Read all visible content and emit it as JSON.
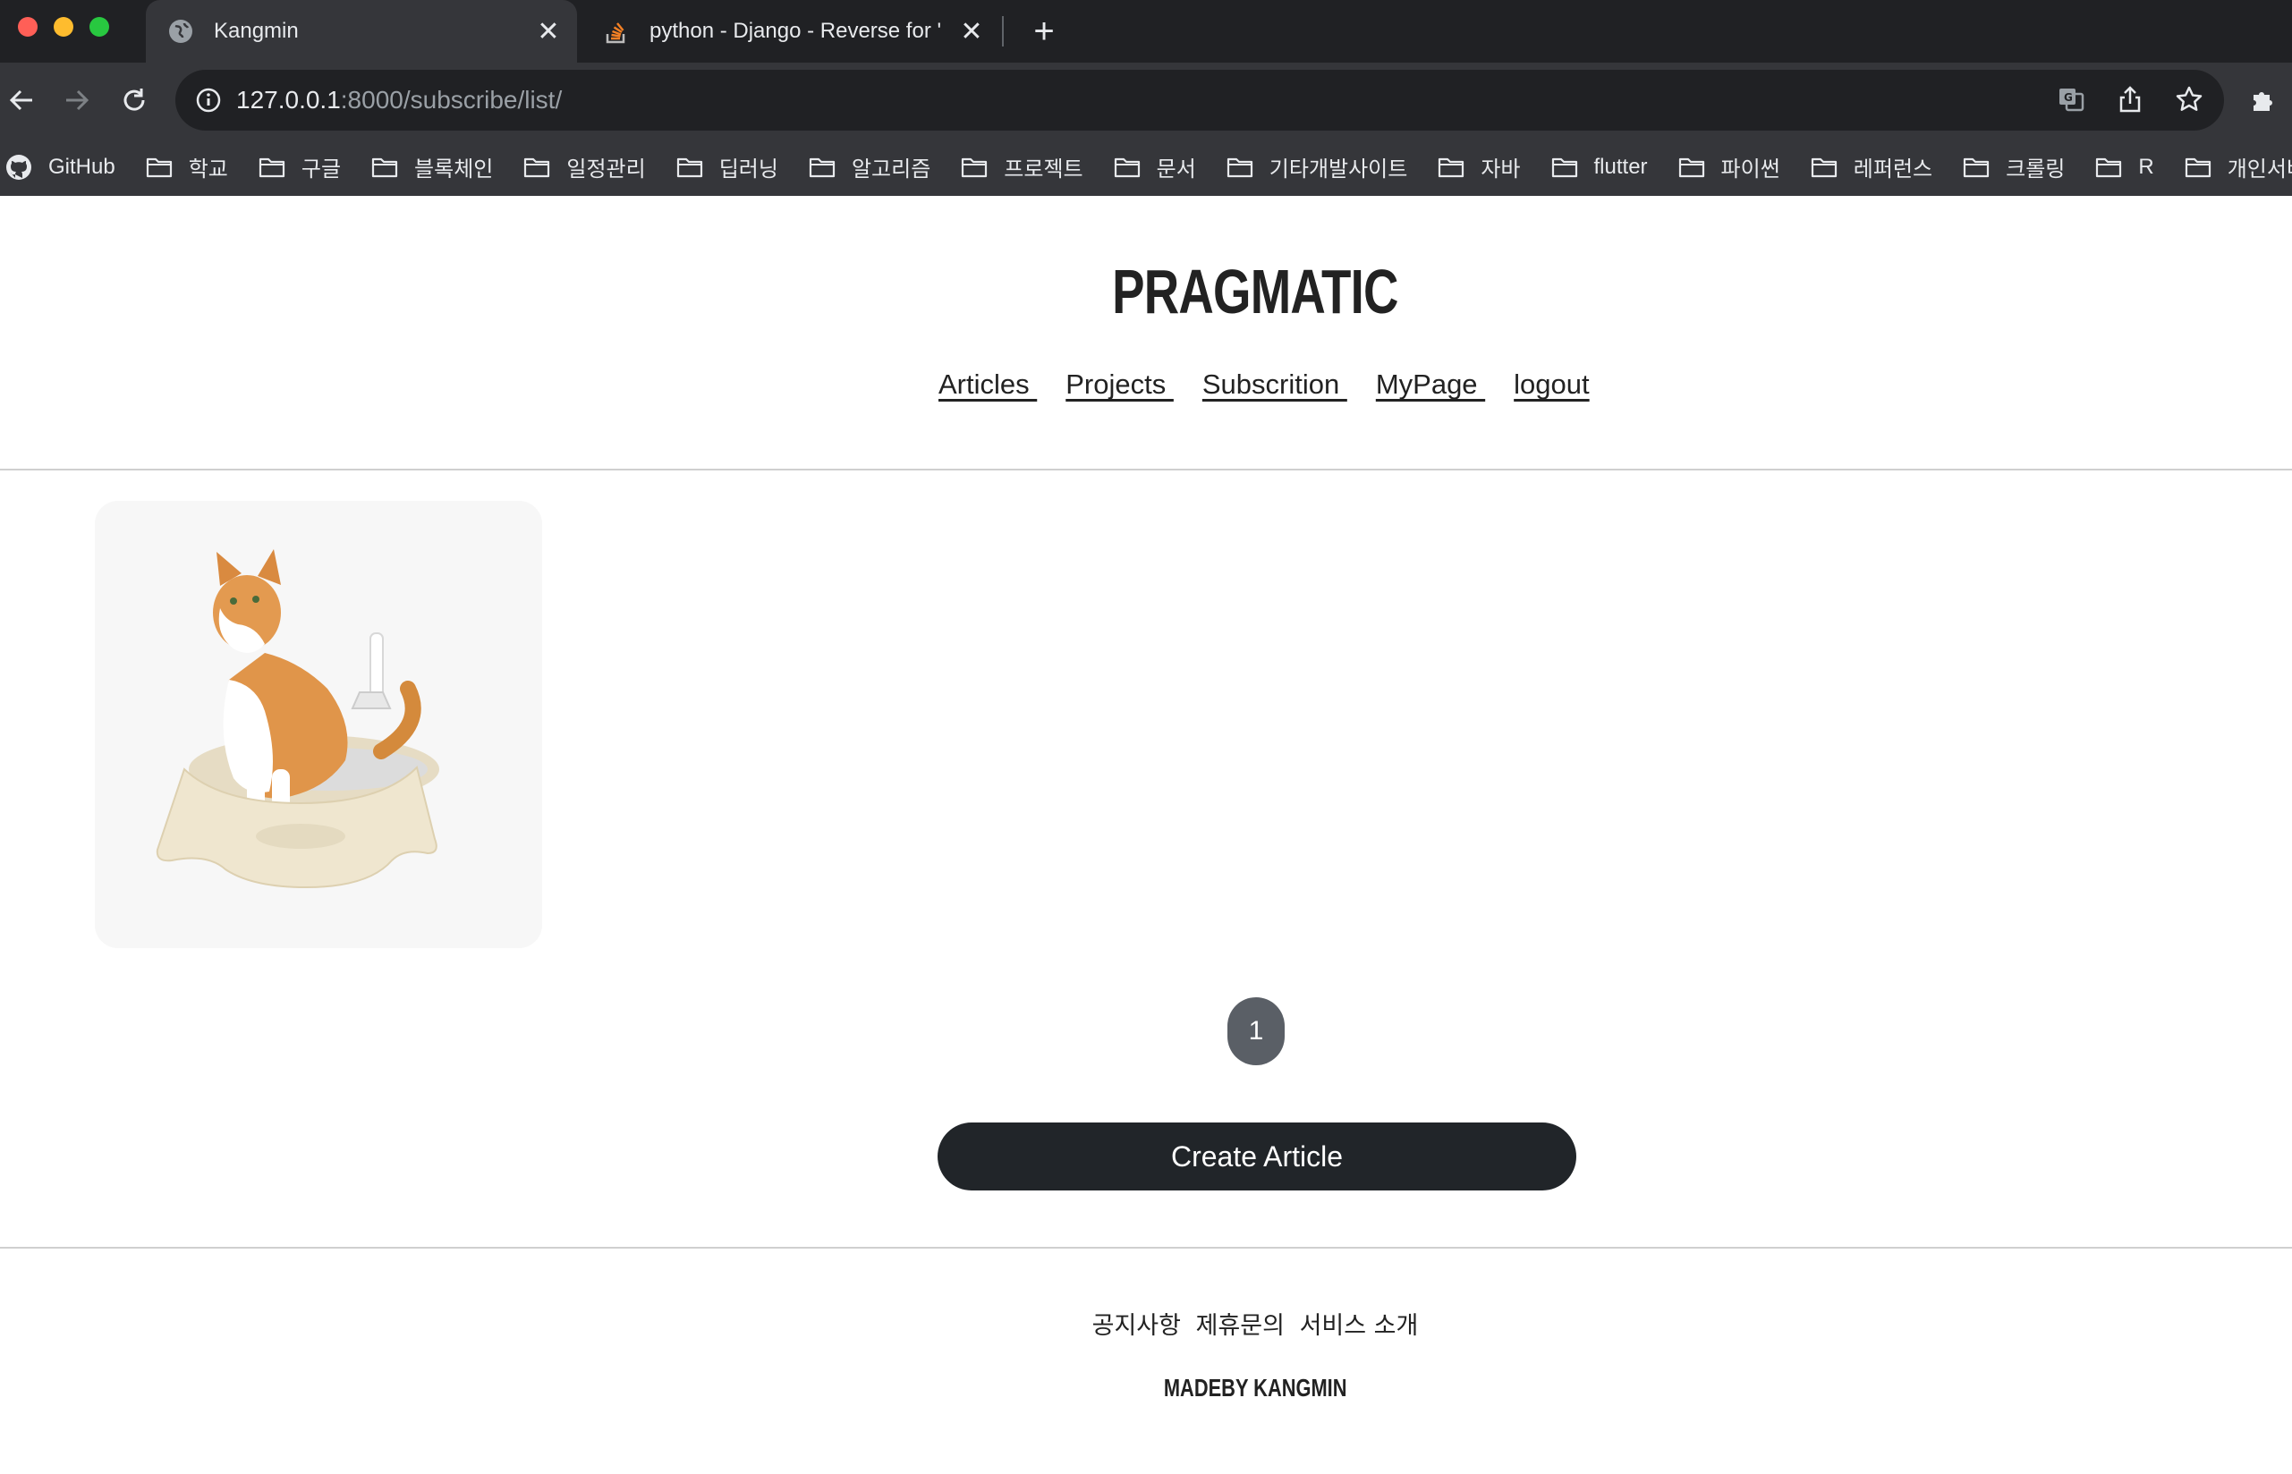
{
  "browser": {
    "tabs": [
      {
        "title": "Kangmin",
        "active": true,
        "favicon": "globe-icon"
      },
      {
        "title": "python - Django - Reverse for '",
        "active": false,
        "favicon": "stackoverflow-icon"
      }
    ],
    "url_host": "127.0.0.1",
    "url_rest": ":8000/subscribe/list/",
    "bookmarks": [
      {
        "label": "GitHub",
        "icon": "github-icon"
      },
      {
        "label": "학교",
        "icon": "folder-icon"
      },
      {
        "label": "구글",
        "icon": "folder-icon"
      },
      {
        "label": "블록체인",
        "icon": "folder-icon"
      },
      {
        "label": "일정관리",
        "icon": "folder-icon"
      },
      {
        "label": "딥러닝",
        "icon": "folder-icon"
      },
      {
        "label": "알고리즘",
        "icon": "folder-icon"
      },
      {
        "label": "프로젝트",
        "icon": "folder-icon"
      },
      {
        "label": "문서",
        "icon": "folder-icon"
      },
      {
        "label": "기타개발사이트",
        "icon": "folder-icon"
      },
      {
        "label": "자바",
        "icon": "folder-icon"
      },
      {
        "label": "flutter",
        "icon": "folder-icon"
      },
      {
        "label": "파이썬",
        "icon": "folder-icon"
      },
      {
        "label": "레퍼런스",
        "icon": "folder-icon"
      },
      {
        "label": "크롤링",
        "icon": "folder-icon"
      },
      {
        "label": "R",
        "icon": "folder-icon"
      },
      {
        "label": "개인서버",
        "icon": "folder-icon"
      }
    ]
  },
  "site": {
    "logo": "PRAGMATIC",
    "nav": [
      "Articles ",
      "Projects ",
      "Subscrition ",
      "MyPage ",
      "logout"
    ]
  },
  "main": {
    "articles": [
      {
        "image": "cat-in-litter-box"
      }
    ],
    "pagination": {
      "current_page": "1"
    },
    "create_button": "Create Article"
  },
  "footer": {
    "links": [
      "공지사항",
      "제휴문의",
      "서비스 소개"
    ],
    "madeby": "MADEBY KANGMIN"
  },
  "colors": {
    "chrome_dark": "#202124",
    "chrome_mid": "#35363a",
    "text_dark": "#222222",
    "button_dark": "#212529",
    "pager_gray": "#5a5f66"
  }
}
